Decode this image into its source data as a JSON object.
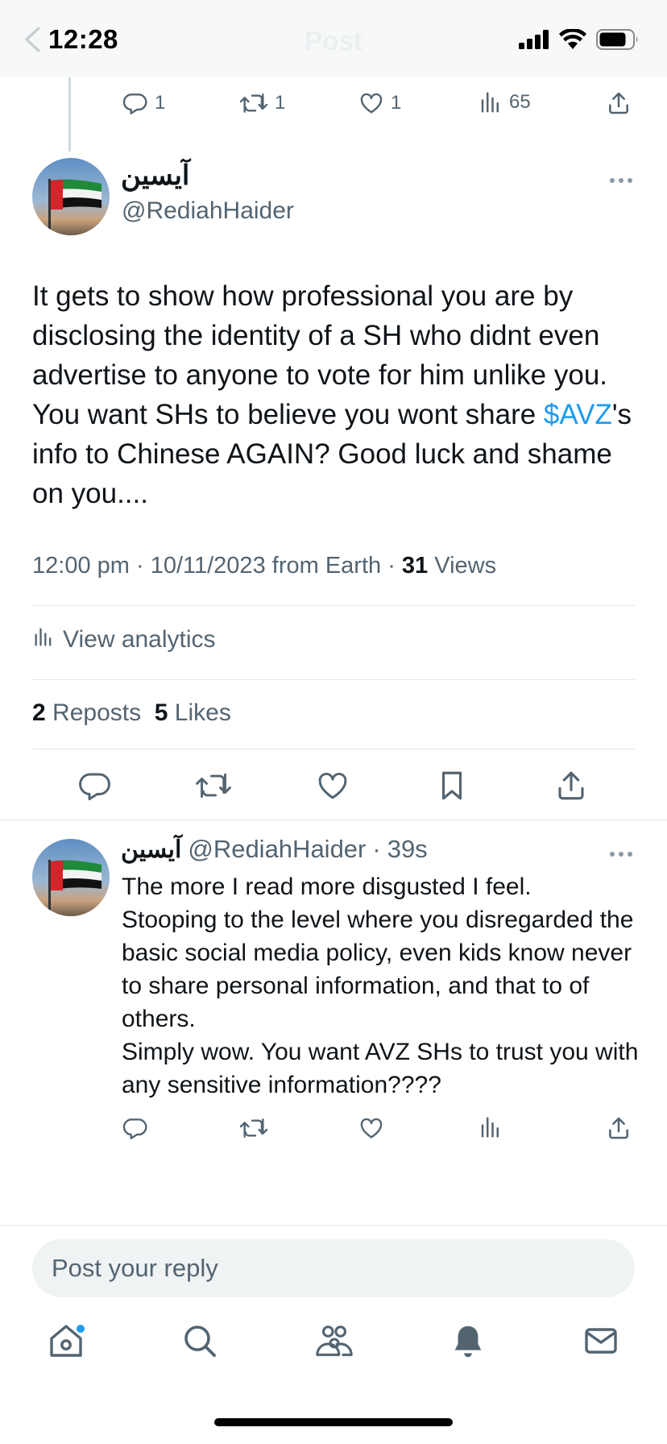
{
  "status_bar": {
    "time": "12:28",
    "nav_title": "Post"
  },
  "parent_actions": {
    "reply_count": "1",
    "repost_count": "1",
    "like_count": "1",
    "views_count": "65"
  },
  "main_post": {
    "display_name": "آیسین",
    "handle": "@RediahHaider",
    "text_before": "It gets to show how professional you are by disclosing the identity of a SH who didnt even advertise to anyone to vote for him unlike you. You want SHs to believe you wont share ",
    "cashtag": "$AVZ",
    "text_after": "'s info to Chinese AGAIN? Good luck and shame on you....",
    "time": "12:00 pm",
    "date": "10/11/2023",
    "source": "from Earth",
    "views_number": "31",
    "views_label": "Views",
    "analytics_label": "View analytics",
    "reposts_number": "2",
    "reposts_label": "Reposts",
    "likes_number": "5",
    "likes_label": "Likes"
  },
  "reply_post": {
    "display_name": "آیسین",
    "handle": "@RediahHaider",
    "age": "39s",
    "text": "The more I read more disgusted I feel.\nStooping to the level where you disregarded the basic social media policy, even kids know never to share personal information, and that to of others.\nSimply wow.  You want AVZ SHs to trust you with any sensitive information????"
  },
  "composer": {
    "placeholder": "Post your reply"
  },
  "colors": {
    "accent": "#1d9bf0",
    "secondary_text": "#536471",
    "divider": "#e1e8ed"
  },
  "icons": [
    "back-arrow-icon",
    "signal-icon",
    "wifi-icon",
    "battery-icon",
    "reply-icon",
    "repost-icon",
    "like-icon",
    "views-icon",
    "share-icon",
    "more-icon",
    "analytics-icon",
    "bookmark-icon",
    "home-icon",
    "search-icon",
    "communities-icon",
    "notifications-icon",
    "messages-icon"
  ]
}
